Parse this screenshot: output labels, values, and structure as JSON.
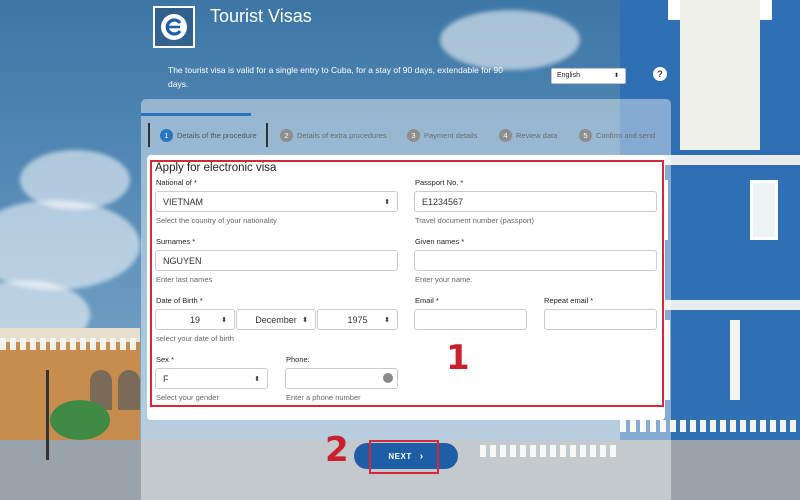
{
  "header": {
    "title": "Tourist Visas",
    "intro": "The tourist visa is valid for a single entry to Cuba, for a stay of 90 days, extendable for 90 days.",
    "language": "English",
    "help_label": "?"
  },
  "steps": [
    {
      "num": "1",
      "label": "Details of the procedure"
    },
    {
      "num": "2",
      "label": "Details of extra procedures"
    },
    {
      "num": "3",
      "label": "Payment details"
    },
    {
      "num": "4",
      "label": "Review data"
    },
    {
      "num": "5",
      "label": "Confirm and send"
    }
  ],
  "form": {
    "title": "Apply for electronic visa",
    "nationality": {
      "label": "National of *",
      "value": "VIETNAM",
      "hint": "Select the country of your nationality"
    },
    "passport": {
      "label": "Passport No. *",
      "value": "E1234567",
      "hint": "Travel document number (passport)"
    },
    "surnames": {
      "label": "Surnames *",
      "value": "NGUYEN",
      "hint": "Enter last names"
    },
    "given_names": {
      "label": "Given names *",
      "value": "",
      "hint": "Enter your name."
    },
    "dob": {
      "label": "Date of Birth *",
      "day": "19",
      "month": "December",
      "year": "1975",
      "hint": "select your date of birth"
    },
    "email": {
      "label": "Email *",
      "value": ""
    },
    "repeat_email": {
      "label": "Repeat email *",
      "value": ""
    },
    "sex": {
      "label": "Sex *",
      "value": "F",
      "hint": "Select your gender"
    },
    "phone": {
      "label": "Phone:",
      "value": "",
      "hint": "Enter a phone number"
    }
  },
  "annotations": {
    "one": "1",
    "two": "2"
  },
  "next_button": {
    "label": "NEXT"
  },
  "colors": {
    "primary": "#2a75bd",
    "button": "#1d5ea6",
    "highlight": "#d3293a"
  }
}
